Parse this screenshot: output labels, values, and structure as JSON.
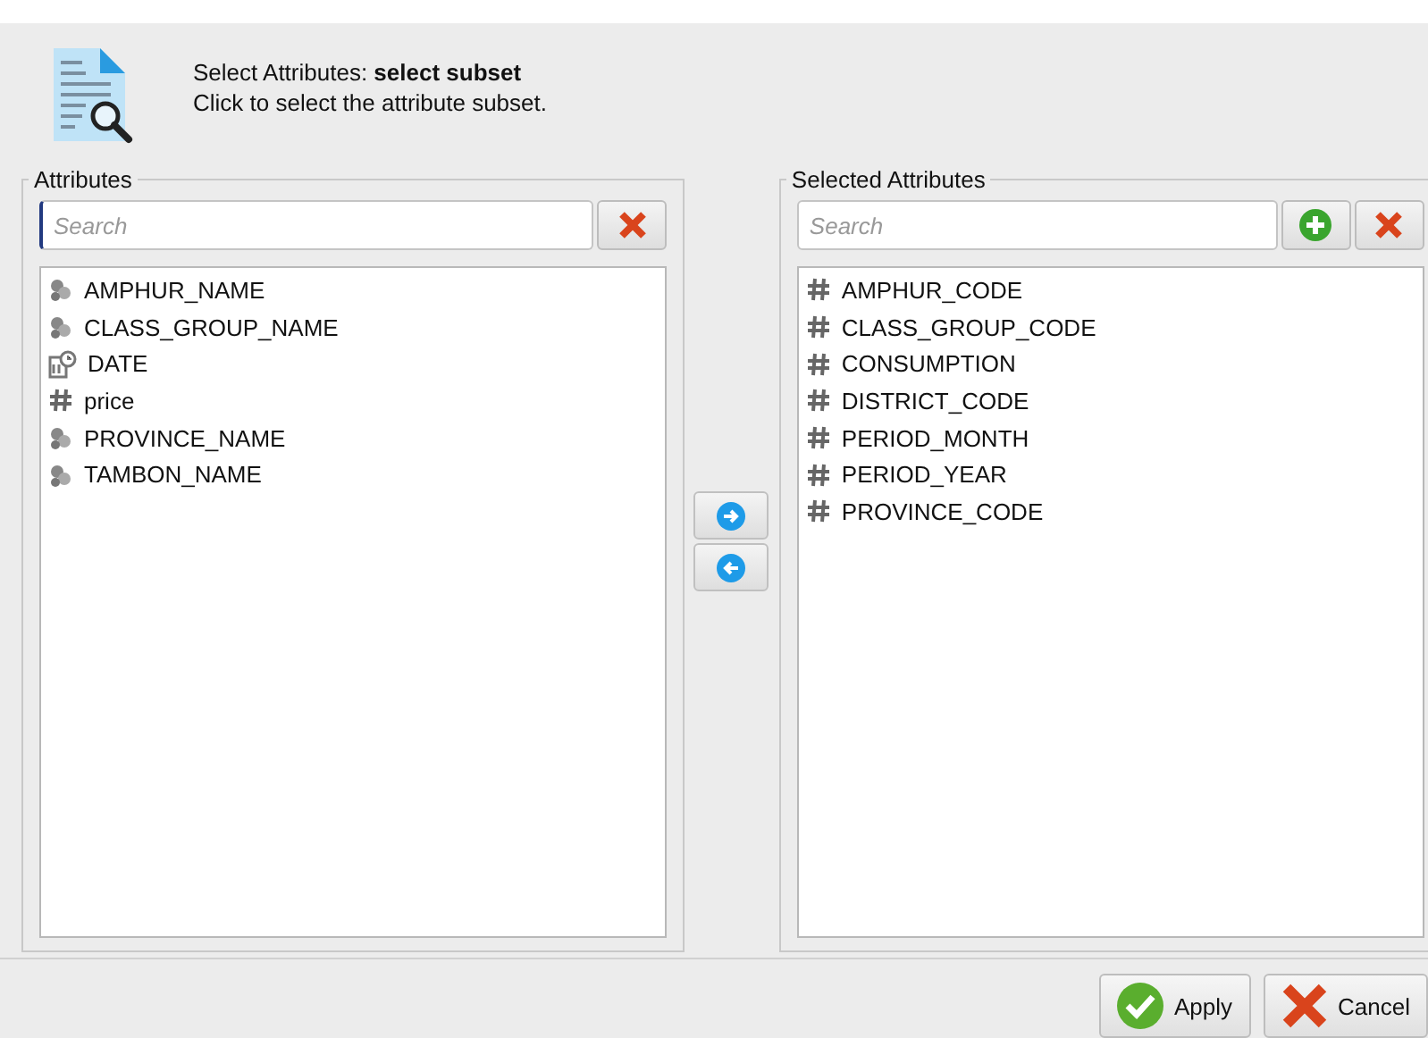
{
  "header": {
    "title": "Select Attributes: **select subset**",
    "subtitle": "Click to select the attribute subset."
  },
  "attributes": {
    "label": "Attributes",
    "search": {
      "placeholder": "Search"
    },
    "items": [
      {
        "name": "AMPHUR_NAME",
        "kind": "nominal"
      },
      {
        "name": "CLASS_GROUP_NAME",
        "kind": "nominal"
      },
      {
        "name": "DATE",
        "kind": "date"
      },
      {
        "name": "price",
        "kind": "numeric"
      },
      {
        "name": "PROVINCE_NAME",
        "kind": "nominal"
      },
      {
        "name": "TAMBON_NAME",
        "kind": "nominal"
      }
    ]
  },
  "selected": {
    "label": "Selected Attributes",
    "search": {
      "placeholder": "Search"
    },
    "items": [
      {
        "name": "AMPHUR_CODE",
        "kind": "numeric"
      },
      {
        "name": "CLASS_GROUP_CODE",
        "kind": "numeric"
      },
      {
        "name": "CONSUMPTION",
        "kind": "numeric"
      },
      {
        "name": "DISTRICT_CODE",
        "kind": "numeric"
      },
      {
        "name": "PERIOD_MONTH",
        "kind": "numeric"
      },
      {
        "name": "PERIOD_YEAR",
        "kind": "numeric"
      },
      {
        "name": "PROVINCE_CODE",
        "kind": "numeric"
      }
    ]
  },
  "buttons": [
    {
      "label": "Apply",
      "kind": "apply"
    },
    {
      "label": "Cancel",
      "kind": "cancel"
    }
  ]
}
